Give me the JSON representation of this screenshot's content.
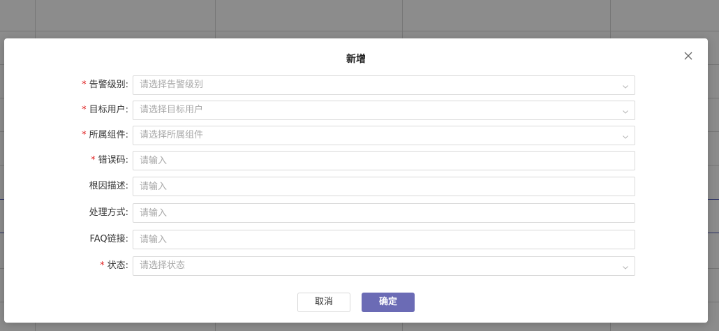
{
  "modal": {
    "title": "新增",
    "fields": [
      {
        "label": "告警级别:",
        "required": true,
        "type": "select",
        "placeholder": "请选择告警级别"
      },
      {
        "label": "目标用户:",
        "required": true,
        "type": "select",
        "placeholder": "请选择目标用户"
      },
      {
        "label": "所属组件:",
        "required": true,
        "type": "select",
        "placeholder": "请选择所属组件"
      },
      {
        "label": "错误码:",
        "required": true,
        "type": "input",
        "placeholder": "请输入"
      },
      {
        "label": "根因描述:",
        "required": false,
        "type": "input",
        "placeholder": "请输入"
      },
      {
        "label": "处理方式:",
        "required": false,
        "type": "input",
        "placeholder": "请输入"
      },
      {
        "label": "FAQ链接:",
        "required": false,
        "type": "input",
        "placeholder": "请输入"
      },
      {
        "label": "状态:",
        "required": true,
        "type": "select",
        "placeholder": "请选择状态"
      }
    ],
    "required_mark": "*",
    "cancel_label": "取消",
    "ok_label": "确定",
    "close_icon": "close-icon",
    "chevron_icon": "chevron-down-icon"
  },
  "colors": {
    "primary": "#6b6bb5",
    "required": "#e02020",
    "overlay": "rgba(0,0,0,0.45)"
  }
}
